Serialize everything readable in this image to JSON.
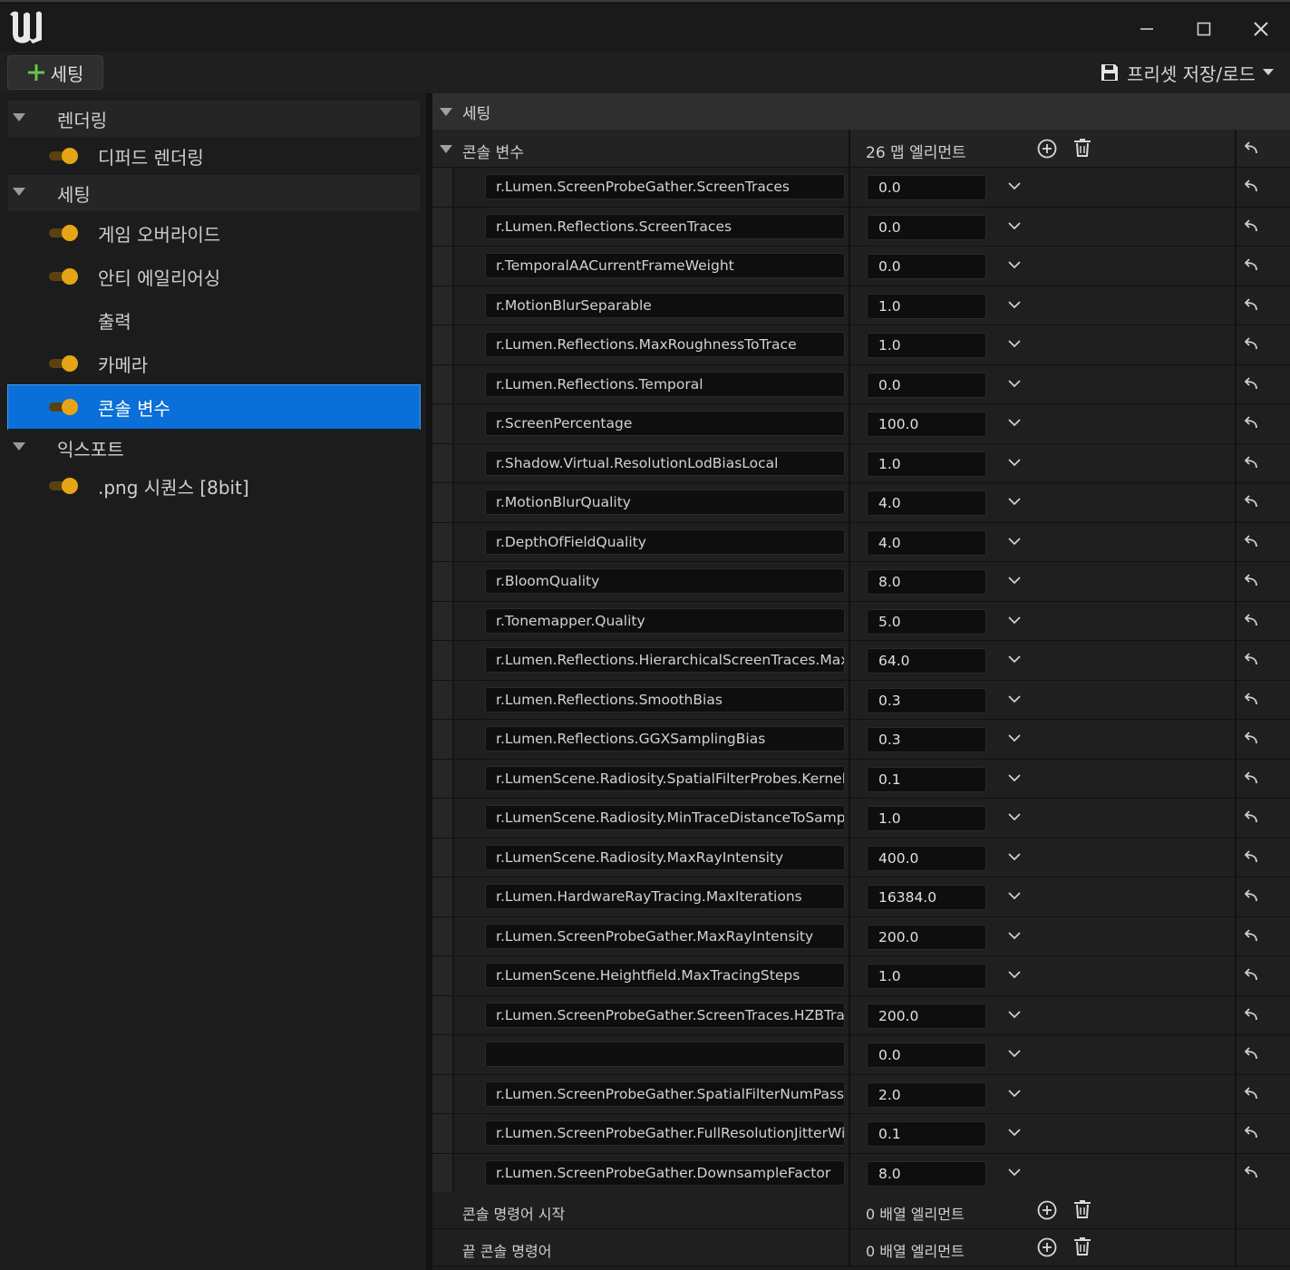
{
  "toolbar": {
    "add_settings_label": "세팅",
    "preset_label": "프리셋 저장/로드"
  },
  "sidebar": {
    "groups": [
      {
        "label": "렌더링",
        "items": [
          {
            "label": "디퍼드 렌더링",
            "enabled": true
          }
        ]
      },
      {
        "label": "세팅",
        "items": [
          {
            "label": "게임 오버라이드",
            "enabled": true
          },
          {
            "label": "안티 에일리어싱",
            "enabled": true
          },
          {
            "label": "출력",
            "enabled": null
          },
          {
            "label": "카메라",
            "enabled": true
          },
          {
            "label": "콘솔 변수",
            "enabled": true,
            "selected": true
          }
        ]
      },
      {
        "label": "익스포트",
        "items": [
          {
            "label": ".png 시퀀스 [8bit]",
            "enabled": true
          }
        ]
      }
    ]
  },
  "details": {
    "section_title": "세팅",
    "cvars": {
      "label": "콘솔 변수",
      "count_text": "26 맵 엘리먼트",
      "entries": [
        {
          "key": "r.Lumen.ScreenProbeGather.ScreenTraces",
          "value": "0.0"
        },
        {
          "key": "r.Lumen.Reflections.ScreenTraces",
          "value": "0.0"
        },
        {
          "key": "r.TemporalAACurrentFrameWeight",
          "value": "0.0"
        },
        {
          "key": "r.MotionBlurSeparable",
          "value": "1.0"
        },
        {
          "key": "r.Lumen.Reflections.MaxRoughnessToTrace",
          "value": "1.0"
        },
        {
          "key": "r.Lumen.Reflections.Temporal",
          "value": "0.0"
        },
        {
          "key": "r.ScreenPercentage",
          "value": "100.0"
        },
        {
          "key": "r.Shadow.Virtual.ResolutionLodBiasLocal",
          "value": "1.0"
        },
        {
          "key": "r.MotionBlurQuality",
          "value": "4.0"
        },
        {
          "key": "r.DepthOfFieldQuality",
          "value": "4.0"
        },
        {
          "key": "r.BloomQuality",
          "value": "8.0"
        },
        {
          "key": "r.Tonemapper.Quality",
          "value": "5.0"
        },
        {
          "key": "r.Lumen.Reflections.HierarchicalScreenTraces.Max",
          "value": "64.0"
        },
        {
          "key": "r.Lumen.Reflections.SmoothBias",
          "value": "0.3"
        },
        {
          "key": "r.Lumen.Reflections.GGXSamplingBias",
          "value": "0.3"
        },
        {
          "key": "r.LumenScene.Radiosity.SpatialFilterProbes.KernelS",
          "value": "0.1"
        },
        {
          "key": "r.LumenScene.Radiosity.MinTraceDistanceToSamp",
          "value": "1.0"
        },
        {
          "key": "r.LumenScene.Radiosity.MaxRayIntensity",
          "value": "400.0"
        },
        {
          "key": "r.Lumen.HardwareRayTracing.MaxIterations",
          "value": "16384.0"
        },
        {
          "key": "r.Lumen.ScreenProbeGather.MaxRayIntensity",
          "value": "200.0"
        },
        {
          "key": "r.LumenScene.Heightfield.MaxTracingSteps",
          "value": "1.0"
        },
        {
          "key": "r.Lumen.ScreenProbeGather.ScreenTraces.HZBTra",
          "value": "200.0"
        },
        {
          "key": "",
          "value": "0.0"
        },
        {
          "key": "r.Lumen.ScreenProbeGather.SpatialFilterNumPasse",
          "value": "2.0"
        },
        {
          "key": "r.Lumen.ScreenProbeGather.FullResolutionJitterWi",
          "value": "0.1"
        },
        {
          "key": "r.Lumen.ScreenProbeGather.DownsampleFactor",
          "value": "8.0"
        }
      ]
    },
    "start_commands": {
      "label": "콘솔 명령어 시작",
      "count_text": "0 배열 엘리먼트"
    },
    "end_commands": {
      "label": "끝 콘솔 명령어",
      "count_text": "0 배열 엘리먼트"
    }
  },
  "colors": {
    "accent": "#e6a516",
    "selection": "#0a6fd8",
    "add_icon": "#6cc44a"
  }
}
